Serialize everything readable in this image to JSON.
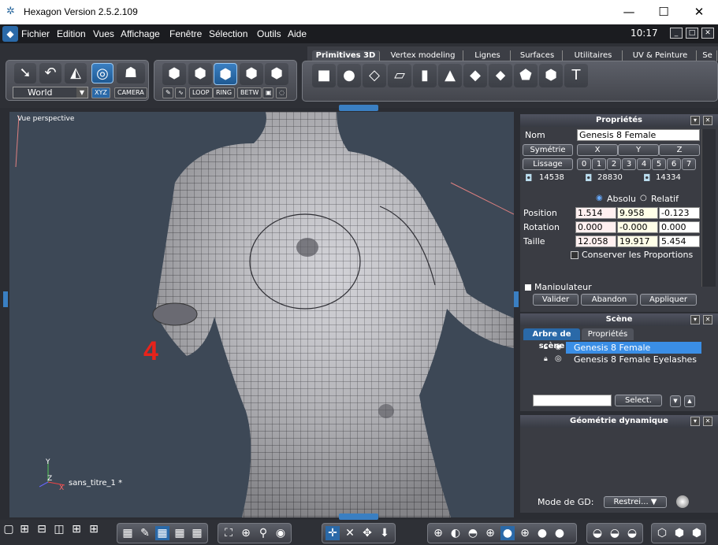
{
  "window": {
    "title": "Hexagon Version 2.5.2.109",
    "minimize": "—",
    "maximize": "☐",
    "close": "✕"
  },
  "menu": {
    "items": [
      "Fichier",
      "Edition",
      "Vues",
      "Affichage",
      "Fenêtre",
      "Sélection",
      "Outils",
      "Aide"
    ],
    "clock": "10:17"
  },
  "toolbar": {
    "coord_space": "World",
    "xyz_label": "XYZ",
    "camera_label": "CAMERA",
    "loop_label": "LOOP",
    "ring_label": "RING",
    "betw_label": "BETW",
    "tabs": [
      "Primitives 3D",
      "Vertex modeling",
      "Lignes",
      "Surfaces",
      "Utilitaires",
      "UV & Peinture",
      "Se"
    ],
    "active_tab": "Primitives 3D"
  },
  "viewport": {
    "label": "Vue perspective",
    "overlay_number": "4",
    "overlay_color": "#e8231b",
    "file_label": "sans_titre_1 *",
    "axis_z": "Z",
    "axis_y": "Y",
    "axis_x": "X"
  },
  "properties": {
    "title": "Propriétés",
    "name_label": "Nom",
    "name_value": "Genesis 8 Female",
    "symmetry_label": "Symétrie",
    "sym_axes": [
      "X",
      "Y",
      "Z"
    ],
    "smoothing_label": "Lissage",
    "levels": [
      "0",
      "1",
      "2",
      "3",
      "4",
      "5",
      "6",
      "7"
    ],
    "count_vertices": "14538",
    "count_faces": "28830",
    "count_polys": "14334",
    "absolute_label": "Absolu",
    "relative_label": "Relatif",
    "position_label": "Position",
    "rotation_label": "Rotation",
    "size_label": "Taille",
    "position": [
      "1.514",
      "9.958",
      "-0.123"
    ],
    "rotation": [
      "0.000",
      "-0.000",
      "0.000"
    ],
    "size": [
      "12.058",
      "19.917",
      "5.454"
    ],
    "keep_proportions": "Conserver les Proportions",
    "manipulator": "Manipulateur",
    "validate": "Valider",
    "abandon": "Abandon",
    "apply": "Appliquer"
  },
  "scene": {
    "title": "Scène",
    "tab_tree": "Arbre de scène",
    "tab_props": "Propriétés",
    "items": [
      {
        "name": "Genesis 8 Female",
        "selected": true
      },
      {
        "name": "Genesis 8 Female Eyelashes",
        "selected": false
      }
    ],
    "select_button": "Select."
  },
  "dyngeo": {
    "title": "Géométrie dynamique",
    "mode_label": "Mode de GD:",
    "mode_value": "Restrei..."
  },
  "colors": {
    "accent": "#2a69a8",
    "selection": "#3a8ee6",
    "menu_bg": "#1b1c20"
  }
}
